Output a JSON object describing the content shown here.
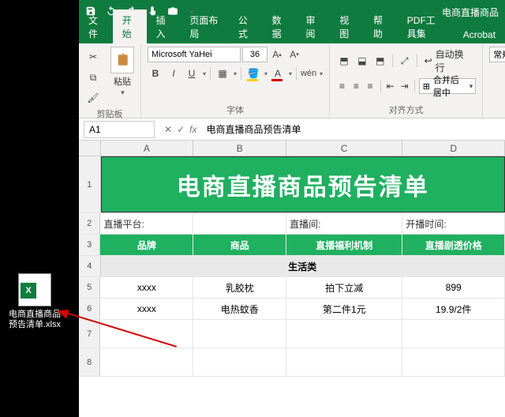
{
  "desktop": {
    "file_label": "电商直播商品预告清单.xlsx",
    "badge": "X"
  },
  "titlebar": {
    "doc_title": "电商直播商品"
  },
  "tabs": {
    "file": "文件",
    "home": "开始",
    "insert": "插入",
    "layout": "页面布局",
    "formulas": "公式",
    "data": "数据",
    "review": "审阅",
    "view": "视图",
    "help": "帮助",
    "pdf": "PDF工具集",
    "acrobat": "Acrobat"
  },
  "ribbon": {
    "paste": "粘贴",
    "clipboard_label": "剪贴板",
    "font_name": "Microsoft YaHei",
    "font_size": "36",
    "font_label": "字体",
    "wrap": "自动换行",
    "merge": "合并后居中",
    "align_label": "对齐方式",
    "general": "常规"
  },
  "formula_bar": {
    "name_box": "A1",
    "fx": "fx",
    "value": "电商直播商品预告清单"
  },
  "columns": [
    "A",
    "B",
    "C",
    "D"
  ],
  "row_numbers": [
    "1",
    "2",
    "3",
    "4",
    "5",
    "6",
    "7",
    "8"
  ],
  "sheet": {
    "banner": "电商直播商品预告清单",
    "r2": {
      "a": "直播平台:",
      "c": "直播间:",
      "d": "开播时间:"
    },
    "r3": {
      "a": "品牌",
      "b": "商品",
      "c": "直播福利机制",
      "d": "直播剧透价格"
    },
    "r4": "生活类",
    "r5": {
      "a": "xxxx",
      "b": "乳胶枕",
      "c": "拍下立减",
      "d": "899"
    },
    "r6": {
      "a": "xxxx",
      "b": "电热蚊香",
      "c": "第二件1元",
      "d": "19.9/2件"
    }
  }
}
